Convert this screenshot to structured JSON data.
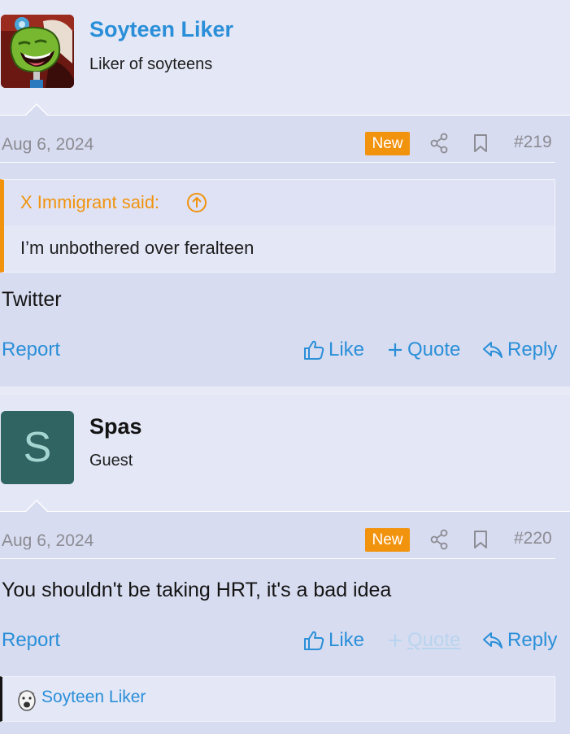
{
  "posts": [
    {
      "username": "Soyteen Liker",
      "user_title": "Liker of soyteens",
      "date": "Aug 6, 2024",
      "badge": "New",
      "number": "#219",
      "quote": {
        "author": "X Immigrant said:",
        "text": "I’m unbothered over feralteen"
      },
      "body": "Twitter",
      "actions": {
        "report": "Report",
        "like": "Like",
        "quote": "Quote",
        "reply": "Reply"
      }
    },
    {
      "username": "Spas",
      "avatar_letter": "S",
      "user_title": "Guest",
      "date": "Aug 6, 2024",
      "badge": "New",
      "number": "#220",
      "body": "You shouldn't be taking HRT, it's a bad idea",
      "actions": {
        "report": "Report",
        "like": "Like",
        "quote": "Quote",
        "reply": "Reply"
      },
      "reactions": {
        "user": "Soyteen Liker"
      }
    }
  ],
  "colors": {
    "link": "#2a8fd8",
    "badge_new": "#f2930e",
    "quote_accent": "#f2930e",
    "avatar_bg": "#2f6463"
  },
  "icons": [
    "share-icon",
    "bookmark-icon",
    "thumbs-up-icon",
    "plus-icon",
    "reply-icon",
    "arrow-up-circle-icon"
  ]
}
